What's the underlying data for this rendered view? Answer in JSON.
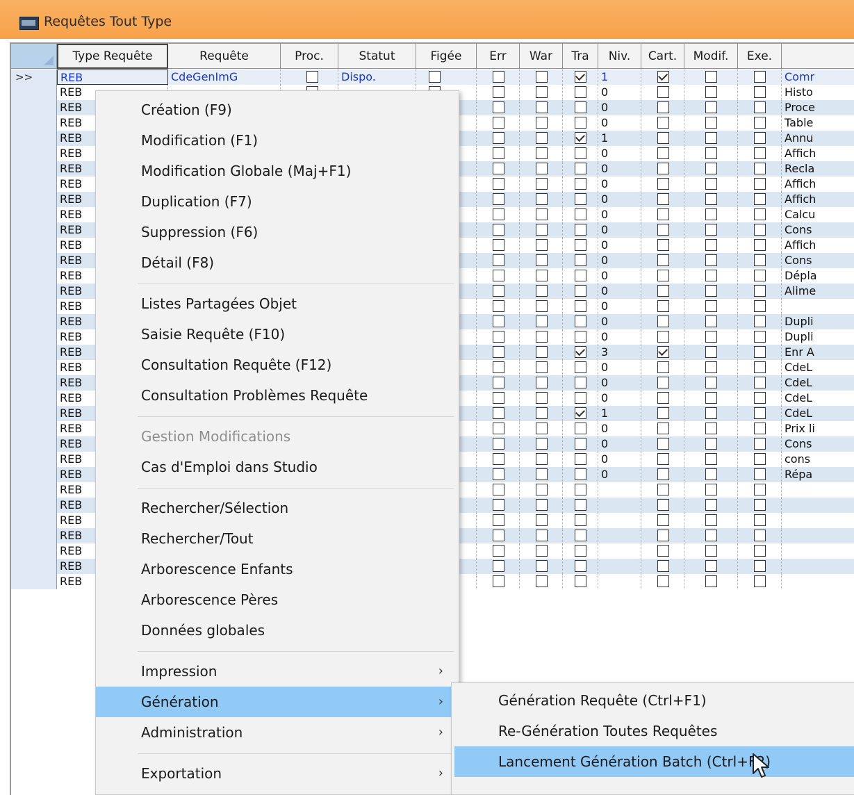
{
  "window": {
    "title": "Requêtes Tout Type"
  },
  "columns": [
    "Type Requête",
    "Requête",
    "Proc.",
    "Statut",
    "Figée",
    "Err",
    "War",
    "Tra",
    "Niv.",
    "Cart.",
    "Modif.",
    "Exe."
  ],
  "current_row": {
    "indicator": ">>",
    "type": "REB",
    "requete": "CdeGenImG",
    "statut": "Dispo.",
    "niv": "1",
    "comment": "Comr"
  },
  "rows": [
    {
      "type": "REB",
      "tra": false,
      "niv": "0",
      "cart": false,
      "comment": "Histo"
    },
    {
      "type": "REB",
      "tra": false,
      "niv": "0",
      "cart": false,
      "comment": "Proce"
    },
    {
      "type": "REB",
      "tra": false,
      "niv": "0",
      "cart": false,
      "comment": "Table"
    },
    {
      "type": "REB",
      "tra": true,
      "niv": "1",
      "cart": false,
      "comment": "Annu"
    },
    {
      "type": "REB",
      "tra": false,
      "niv": "0",
      "cart": false,
      "comment": "Affich"
    },
    {
      "type": "REB",
      "tra": false,
      "niv": "0",
      "cart": false,
      "comment": "Recla"
    },
    {
      "type": "REB",
      "tra": false,
      "niv": "0",
      "cart": false,
      "comment": "Affich"
    },
    {
      "type": "REB",
      "tra": false,
      "niv": "0",
      "cart": false,
      "comment": "Affich"
    },
    {
      "type": "REB",
      "tra": false,
      "niv": "0",
      "cart": false,
      "comment": "Calcu"
    },
    {
      "type": "REB",
      "tra": false,
      "niv": "0",
      "cart": false,
      "comment": "Cons"
    },
    {
      "type": "REB",
      "tra": false,
      "niv": "0",
      "cart": false,
      "comment": "Affich"
    },
    {
      "type": "REB",
      "tra": false,
      "niv": "0",
      "cart": false,
      "comment": "Cons"
    },
    {
      "type": "REB",
      "tra": false,
      "niv": "0",
      "cart": false,
      "comment": "Dépla"
    },
    {
      "type": "REB",
      "tra": false,
      "niv": "0",
      "cart": false,
      "comment": "Alime"
    },
    {
      "type": "REB",
      "tra": false,
      "niv": "0",
      "cart": false,
      "comment": ""
    },
    {
      "type": "REB",
      "tra": false,
      "niv": "0",
      "cart": false,
      "comment": "Dupli"
    },
    {
      "type": "REB",
      "tra": false,
      "niv": "0",
      "cart": false,
      "comment": "Dupli"
    },
    {
      "type": "REB",
      "tra": true,
      "niv": "3",
      "cart": true,
      "comment": "Enr A"
    },
    {
      "type": "REB",
      "tra": false,
      "niv": "0",
      "cart": false,
      "comment": "CdeL"
    },
    {
      "type": "REB",
      "tra": false,
      "niv": "0",
      "cart": false,
      "comment": "CdeL"
    },
    {
      "type": "REB",
      "tra": false,
      "niv": "0",
      "cart": false,
      "comment": "CdeL"
    },
    {
      "type": "REB",
      "tra": true,
      "niv": "1",
      "cart": false,
      "comment": "CdeL"
    },
    {
      "type": "REB",
      "tra": false,
      "niv": "0",
      "cart": false,
      "comment": "Prix li"
    },
    {
      "type": "REB",
      "tra": false,
      "niv": "0",
      "cart": false,
      "comment": "Cons"
    },
    {
      "type": "REB",
      "tra": false,
      "niv": "0",
      "cart": false,
      "comment": "cons"
    },
    {
      "type": "REB",
      "tra": false,
      "niv": "0",
      "cart": false,
      "comment": "Répa"
    },
    {
      "type": "REB",
      "tra": false,
      "niv": "",
      "cart": false,
      "comment": ""
    },
    {
      "type": "REB",
      "tra": false,
      "niv": "",
      "cart": false,
      "comment": ""
    },
    {
      "type": "REB",
      "tra": false,
      "niv": "",
      "cart": false,
      "comment": ""
    },
    {
      "type": "REB",
      "tra": false,
      "niv": "",
      "cart": false,
      "comment": ""
    },
    {
      "type": "REB",
      "tra": false,
      "niv": "",
      "cart": false,
      "comment": ""
    },
    {
      "type": "REB",
      "tra": false,
      "niv": "",
      "cart": false,
      "comment": ""
    },
    {
      "type": "REB",
      "tra": false,
      "niv": "",
      "cart": false,
      "comment": ""
    }
  ],
  "context_menu": [
    {
      "label": "Création (F9)"
    },
    {
      "label": "Modification (F1)"
    },
    {
      "label": "Modification Globale (Maj+F1)"
    },
    {
      "label": "Duplication (F7)"
    },
    {
      "label": "Suppression (F6)"
    },
    {
      "label": "Détail (F8)"
    },
    {
      "separator": true
    },
    {
      "label": "Listes Partagées Objet"
    },
    {
      "label": "Saisie Requête (F10)"
    },
    {
      "label": "Consultation Requête (F12)"
    },
    {
      "label": "Consultation Problèmes Requête"
    },
    {
      "separator": true
    },
    {
      "label": "Gestion Modifications",
      "disabled": true
    },
    {
      "label": "Cas d'Emploi dans Studio"
    },
    {
      "separator": true
    },
    {
      "label": "Rechercher/Sélection"
    },
    {
      "label": "Rechercher/Tout"
    },
    {
      "label": "Arborescence Enfants"
    },
    {
      "label": "Arborescence Pères"
    },
    {
      "label": "Données globales"
    },
    {
      "separator": true
    },
    {
      "label": "Impression",
      "submenu": true
    },
    {
      "label": "Génération",
      "submenu": true,
      "highlighted": true
    },
    {
      "label": "Administration",
      "submenu": true
    },
    {
      "separator": true
    },
    {
      "label": "Exportation",
      "submenu": true
    }
  ],
  "submenu_generation": [
    {
      "label": "Génération Requête (Ctrl+F1)"
    },
    {
      "label": "Re-Génération Toutes Requêtes"
    },
    {
      "label": "Lancement Génération Batch (Ctrl+F2)",
      "highlighted": true
    }
  ],
  "icons": {
    "submenu_arrow": "chevron-right-icon",
    "cursor": "mouse-pointer-icon",
    "window_icon": "app-window-icon"
  },
  "colors": {
    "titlebar": "#f7a24a",
    "menu_highlight": "#91c9f7",
    "row_alt": "#dbe6f3",
    "link_text": "#1a38c9"
  }
}
